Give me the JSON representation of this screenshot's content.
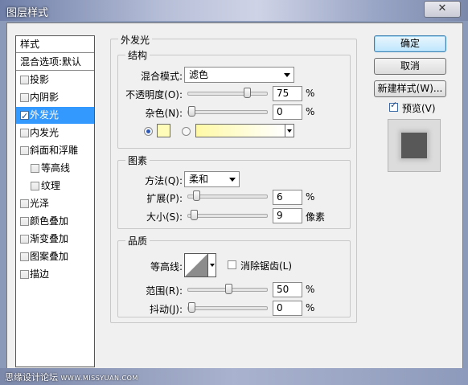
{
  "window": {
    "title": "图层样式",
    "close_glyph": "✕"
  },
  "watermark": {
    "text": "思缘设计论坛",
    "url": "WWW.MISSYUAN.COM"
  },
  "style_list": {
    "header": "样式",
    "blend_default": "混合选项:默认",
    "items": [
      {
        "label": "投影",
        "checked": false
      },
      {
        "label": "内阴影",
        "checked": false
      },
      {
        "label": "外发光",
        "checked": true,
        "selected": true
      },
      {
        "label": "内发光",
        "checked": false
      },
      {
        "label": "斜面和浮雕",
        "checked": false
      },
      {
        "label": "等高线",
        "checked": false,
        "indent": true
      },
      {
        "label": "纹理",
        "checked": false,
        "indent": true
      },
      {
        "label": "光泽",
        "checked": false
      },
      {
        "label": "颜色叠加",
        "checked": false
      },
      {
        "label": "渐变叠加",
        "checked": false
      },
      {
        "label": "图案叠加",
        "checked": false
      },
      {
        "label": "描边",
        "checked": false
      }
    ]
  },
  "outer_glow": {
    "title": "外发光",
    "structure": {
      "title": "结构",
      "blend_mode_label": "混合模式:",
      "blend_mode_value": "滤色",
      "opacity_label": "不透明度(O):",
      "opacity_value": "75",
      "opacity_level": 0.75,
      "noise_label": "杂色(N):",
      "noise_value": "0",
      "noise_level": 0,
      "percent": "%",
      "color_swatch": "#fffbb8",
      "gradient_colors": [
        "#fff9a6",
        "#ffffff"
      ]
    },
    "elements": {
      "title": "图素",
      "method_label": "方法(Q):",
      "method_value": "柔和",
      "spread_label": "扩展(P):",
      "spread_value": "6",
      "spread_level": 0.06,
      "size_label": "大小(S):",
      "size_value": "9",
      "size_level": 0.036,
      "size_unit": "像素",
      "percent": "%"
    },
    "quality": {
      "title": "品质",
      "contour_label": "等高线:",
      "anti_alias_label": "消除锯齿(L)",
      "range_label": "范围(R):",
      "range_value": "50",
      "range_level": 0.5,
      "jitter_label": "抖动(J):",
      "jitter_value": "0",
      "jitter_level": 0,
      "percent": "%"
    }
  },
  "actions": {
    "ok_label": "确定",
    "cancel_label": "取消",
    "new_style_label": "新建样式(W)...",
    "preview_label": "预览(V)",
    "preview_checked": true
  },
  "colors": {
    "selection": "#3399ff",
    "panel": "#f0f0f0"
  }
}
